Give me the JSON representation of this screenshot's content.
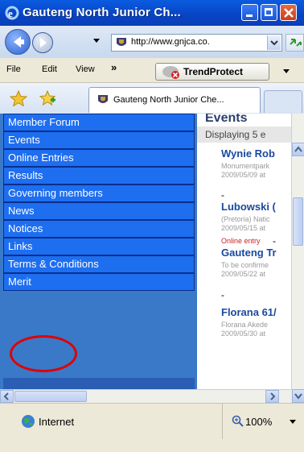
{
  "window": {
    "title": "Gauteng North Junior Ch..."
  },
  "address": {
    "url": "http://www.gnjca.co."
  },
  "menu": {
    "file": "File",
    "edit": "Edit",
    "view": "View",
    "more": "»"
  },
  "toolbar": {
    "trend_label": "TrendProtect"
  },
  "tab": {
    "title": "Gauteng North Junior Che..."
  },
  "sidebar": {
    "items": [
      {
        "label": "Member Forum"
      },
      {
        "label": "Events"
      },
      {
        "label": "Online Entries"
      },
      {
        "label": "Results"
      },
      {
        "label": "Governing members"
      },
      {
        "label": "News"
      },
      {
        "label": "Notices"
      },
      {
        "label": "Links"
      },
      {
        "label": "Terms & Conditions"
      },
      {
        "label": "Merit"
      }
    ]
  },
  "main": {
    "heading": "Events",
    "displaying": "Displaying 5 e",
    "events": [
      {
        "title": "Wynie Rob",
        "location": "Monumentpark",
        "date": "2009/05/09 at"
      },
      {
        "title": "Lubowski (",
        "location": "(Pretoria) Natic",
        "date": "2009/05/15 at",
        "entry": "Online entry"
      },
      {
        "title": "Gauteng Tr",
        "location": "To be confirme",
        "date": "2009/05/22 at"
      },
      {
        "title": "Florana 61/",
        "location": "Florana Akede",
        "date": "2009/05/30 at"
      }
    ],
    "dash": "-"
  },
  "status": {
    "zone": "Internet",
    "zoom": "100%"
  },
  "colors": {
    "sidebar_item": "#1e6ef0",
    "background": "#3a79c8",
    "highlight_circle": "#e00000",
    "link": "#1a4aa0"
  }
}
